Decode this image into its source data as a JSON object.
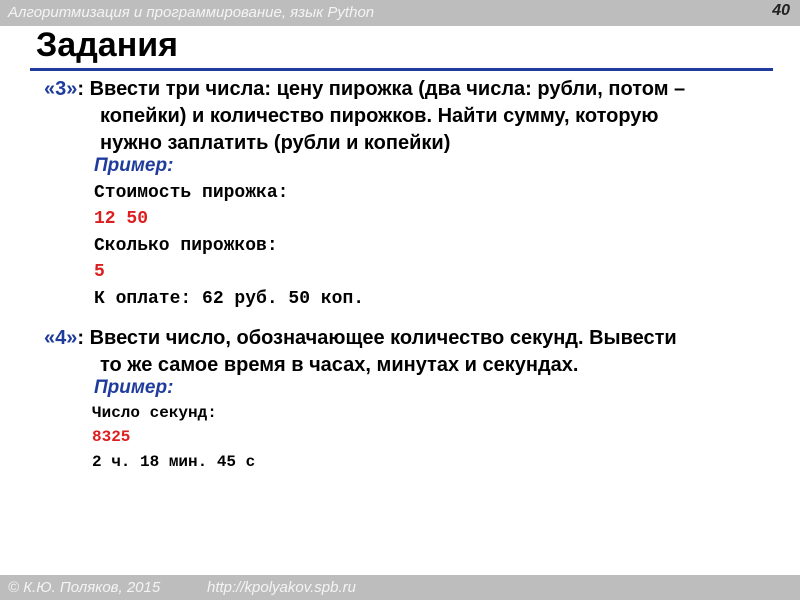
{
  "header": {
    "course_title": "Алгоритмизация и программирование, язык Python",
    "page_number": "40"
  },
  "slide": {
    "title": "Задания"
  },
  "task3": {
    "id": "«3»",
    "line1": ": Ввести три числа: цену пирожка (два числа: рубли, потом –",
    "line2": "копейки) и количество пирожков. Найти сумму, которую",
    "line3": "нужно заплатить (рубли и копейки)",
    "example_label": "Пример:",
    "example_lines": [
      "Стоимость пирожка:",
      "12 50",
      "Сколько пирожков:",
      "5",
      "К оплате: 62 руб. 50 коп."
    ]
  },
  "task4": {
    "id": "«4»",
    "line1": ": Ввести число, обозначающее количество секунд. Вывести",
    "line2": "то же самое время в часах, минутах и секундах.",
    "example_label": "Пример:",
    "example_lines": [
      "Число секунд:",
      "8325",
      "2 ч. 18 мин. 45 с"
    ]
  },
  "footer": {
    "author": "© К.Ю. Поляков, 2015",
    "url": "http://kpolyakov.spb.ru"
  },
  "colors": {
    "accent_blue": "#1f3c9c",
    "input_red": "#dd1e1e",
    "bar_gray": "#bdbdbd"
  }
}
